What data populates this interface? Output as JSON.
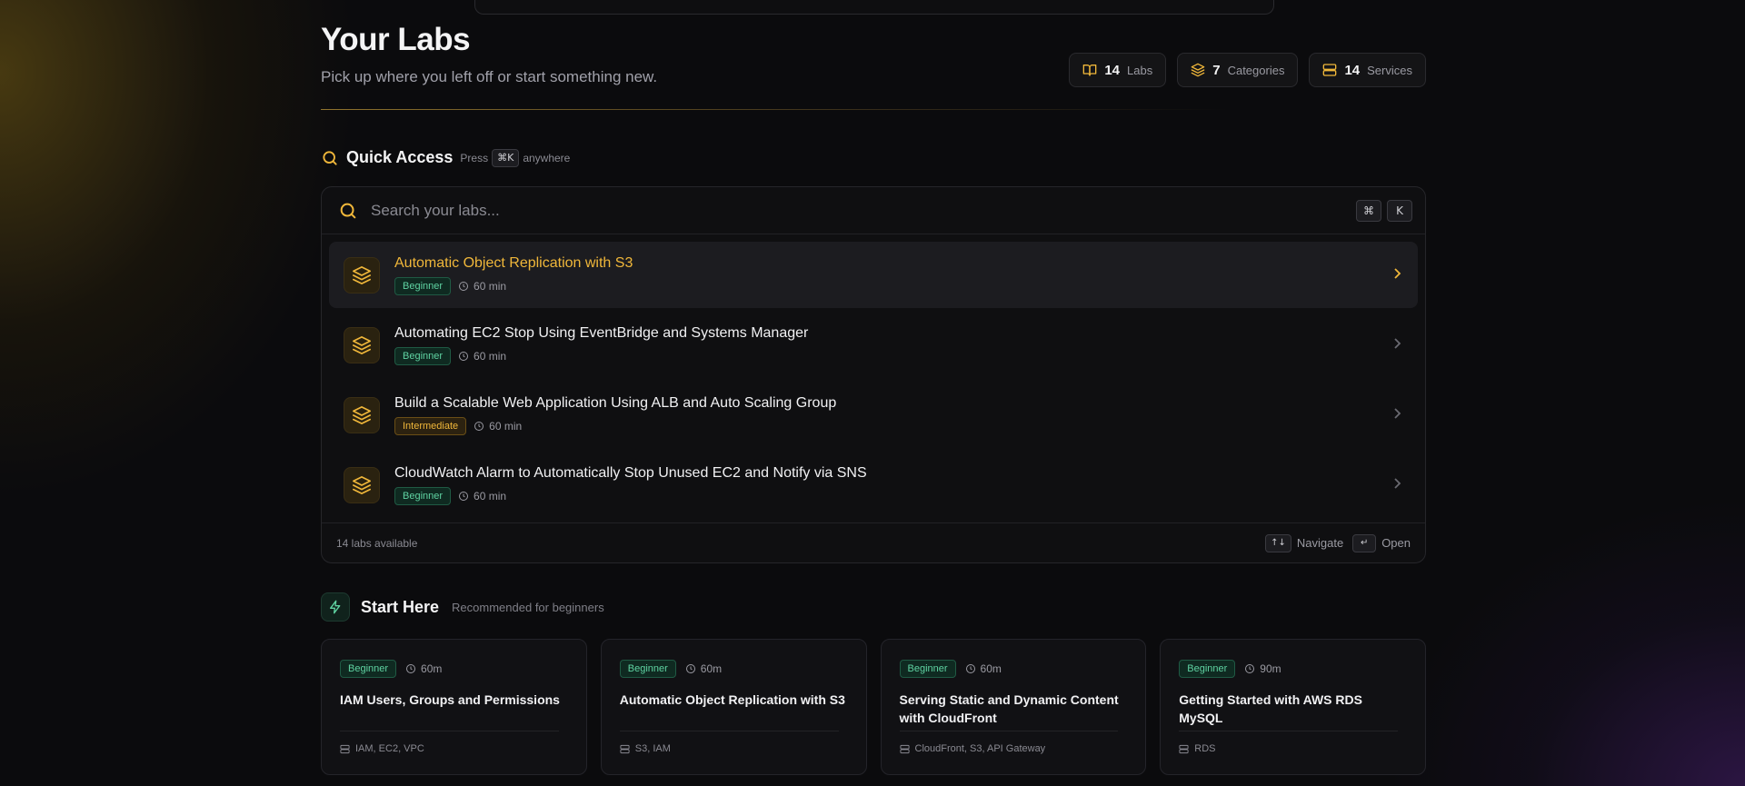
{
  "header": {
    "title": "Your Labs",
    "subtitle": "Pick up where you left off or start something new."
  },
  "stats": [
    {
      "icon": "book-icon",
      "value": "14",
      "label": "Labs"
    },
    {
      "icon": "layers-icon",
      "value": "7",
      "label": "Categories"
    },
    {
      "icon": "server-icon",
      "value": "14",
      "label": "Services"
    }
  ],
  "quick_access": {
    "title": "Quick Access",
    "hint_prefix": "Press",
    "hint_key": "⌘K",
    "hint_suffix": "anywhere",
    "search_placeholder": "Search your labs...",
    "search_key_1": "⌘",
    "search_key_2": "K",
    "results": [
      {
        "title": "Automatic Object Replication with S3",
        "level": "Beginner",
        "duration": "60 min",
        "active": true
      },
      {
        "title": "Automating EC2 Stop Using EventBridge and Systems Manager",
        "level": "Beginner",
        "duration": "60 min",
        "active": false
      },
      {
        "title": "Build a Scalable Web Application Using ALB and Auto Scaling Group",
        "level": "Intermediate",
        "duration": "60 min",
        "active": false
      },
      {
        "title": "CloudWatch Alarm to Automatically Stop Unused EC2 and Notify via SNS",
        "level": "Beginner",
        "duration": "60 min",
        "active": false
      }
    ],
    "footer_count": "14 labs available",
    "navigate_key": "↑↓",
    "navigate_label": "Navigate",
    "open_key": "↵",
    "open_label": "Open"
  },
  "start_here": {
    "title": "Start Here",
    "subtitle": "Recommended for beginners",
    "cards": [
      {
        "level": "Beginner",
        "duration": "60m",
        "title": "IAM Users, Groups and Permissions",
        "services": "IAM, EC2, VPC"
      },
      {
        "level": "Beginner",
        "duration": "60m",
        "title": "Automatic Object Replication with S3",
        "services": "S3, IAM"
      },
      {
        "level": "Beginner",
        "duration": "60m",
        "title": "Serving Static and Dynamic Content with CloudFront",
        "services": "CloudFront, S3, API Gateway"
      },
      {
        "level": "Beginner",
        "duration": "90m",
        "title": "Getting Started with AWS RDS MySQL",
        "services": "RDS"
      }
    ]
  },
  "colors": {
    "accent": "#f0b73a",
    "green": "#5fd3a2",
    "background": "#0b0b0d"
  }
}
